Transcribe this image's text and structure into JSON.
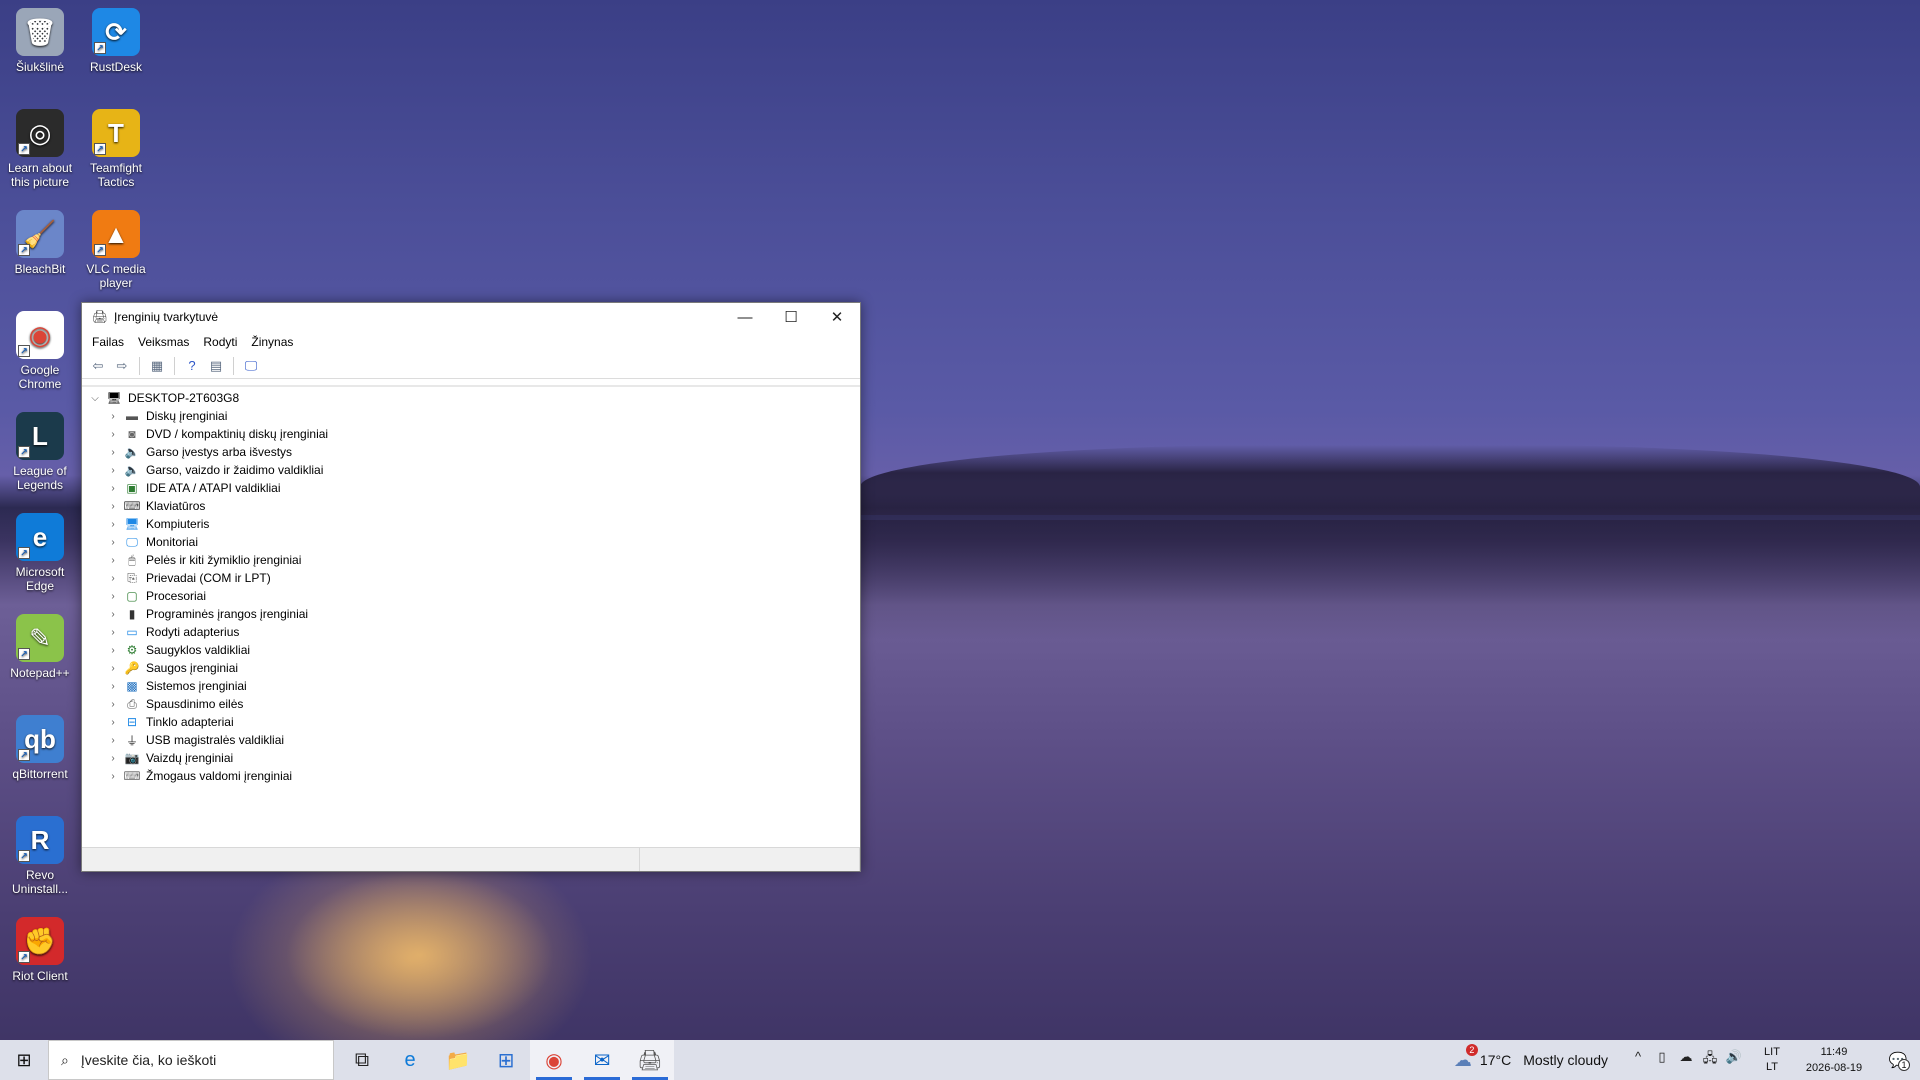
{
  "desktop": {
    "icons": [
      {
        "label": "Šiukšlinė",
        "glyph": "🗑",
        "icon": "recycle-bin-icon"
      },
      {
        "label": "RustDesk",
        "glyph": "⟳",
        "icon": "rustdesk-icon"
      },
      {
        "label": "Learn about this picture",
        "glyph": "◎",
        "icon": "learn-picture-icon"
      },
      {
        "label": "Teamfight Tactics",
        "glyph": "T",
        "icon": "teamfight-tactics-icon"
      },
      {
        "label": "BleachBit",
        "glyph": "🧹",
        "icon": "bleachbit-icon"
      },
      {
        "label": "VLC media player",
        "glyph": "▲",
        "icon": "vlc-icon"
      },
      {
        "label": "Google Chrome",
        "glyph": "◉",
        "icon": "chrome-icon"
      },
      {
        "label": "League of Legends",
        "glyph": "L",
        "icon": "league-of-legends-icon"
      },
      {
        "label": "Microsoft Edge",
        "glyph": "e",
        "icon": "edge-icon"
      },
      {
        "label": "Notepad++",
        "glyph": "✎",
        "icon": "notepad-plus-plus-icon"
      },
      {
        "label": "qBittorrent",
        "glyph": "qb",
        "icon": "qbittorrent-icon"
      },
      {
        "label": "Revo Uninstall...",
        "glyph": "R",
        "icon": "revo-uninstaller-icon"
      },
      {
        "label": "Riot Client",
        "glyph": "✊",
        "icon": "riot-client-icon"
      }
    ]
  },
  "window": {
    "title": "Įrenginių tvarkytuvė",
    "controls": {
      "minimize": "—",
      "maximize": "☐",
      "close": "✕"
    },
    "menu": [
      "Failas",
      "Veiksmas",
      "Rodyti",
      "Žinynas"
    ],
    "toolbar": [
      {
        "glyph": "⇦",
        "icon": "back-arrow-icon"
      },
      {
        "glyph": "⇨",
        "icon": "forward-arrow-icon"
      },
      {
        "glyph": "▦",
        "icon": "properties-view-icon"
      },
      {
        "glyph": "?",
        "icon": "help-icon"
      },
      {
        "glyph": "▤",
        "icon": "details-view-icon"
      },
      {
        "glyph": "🖵",
        "icon": "monitor-scan-icon"
      }
    ],
    "tree": {
      "root": {
        "label": "DESKTOP-2T603G8",
        "glyph": "🖥",
        "icon": "computer-icon"
      },
      "items": [
        {
          "label": "Diskų įrenginiai",
          "glyph": "▬",
          "icon": "disk-drive-icon"
        },
        {
          "label": "DVD / kompaktinių diskų įrenginiai",
          "glyph": "◙",
          "icon": "dvd-drive-icon"
        },
        {
          "label": "Garso įvestys arba išvestys",
          "glyph": "🔈",
          "icon": "audio-io-icon"
        },
        {
          "label": "Garso, vaizdo ir žaidimo valdikliai",
          "glyph": "🔈",
          "icon": "sound-video-game-icon"
        },
        {
          "label": "IDE ATA / ATAPI valdikliai",
          "glyph": "▣",
          "icon": "ide-controller-icon"
        },
        {
          "label": "Klaviatūros",
          "glyph": "⌨",
          "icon": "keyboard-icon"
        },
        {
          "label": "Kompiuteris",
          "glyph": "🖥",
          "icon": "computer-category-icon"
        },
        {
          "label": "Monitoriai",
          "glyph": "🖵",
          "icon": "monitor-icon"
        },
        {
          "label": "Pelės ir kiti žymiklio įrenginiai",
          "glyph": "🖱",
          "icon": "mouse-icon"
        },
        {
          "label": "Prievadai (COM ir LPT)",
          "glyph": "⎘",
          "icon": "ports-icon"
        },
        {
          "label": "Procesoriai",
          "glyph": "▢",
          "icon": "processor-icon"
        },
        {
          "label": "Programinės įrangos įrenginiai",
          "glyph": "▮",
          "icon": "software-device-icon"
        },
        {
          "label": "Rodyti adapterius",
          "glyph": "▭",
          "icon": "display-adapter-icon"
        },
        {
          "label": "Saugyklos valdikliai",
          "glyph": "⚙",
          "icon": "storage-controller-icon"
        },
        {
          "label": "Saugos įrenginiai",
          "glyph": "🔑",
          "icon": "security-device-icon"
        },
        {
          "label": "Sistemos įrenginiai",
          "glyph": "▩",
          "icon": "system-device-icon"
        },
        {
          "label": "Spausdinimo eilės",
          "glyph": "⎙",
          "icon": "print-queue-icon"
        },
        {
          "label": "Tinklo adapteriai",
          "glyph": "⊟",
          "icon": "network-adapter-icon"
        },
        {
          "label": "USB magistralės valdikliai",
          "glyph": "⏚",
          "icon": "usb-controller-icon"
        },
        {
          "label": "Vaizdų įrenginiai",
          "glyph": "📷",
          "icon": "imaging-device-icon"
        },
        {
          "label": "Žmogaus valdomi įrenginiai",
          "glyph": "⌨",
          "icon": "hid-icon"
        }
      ]
    }
  },
  "taskbar": {
    "start_glyph": "⊞",
    "search_placeholder": "Įveskite čia, ko ieškoti",
    "apps": [
      {
        "glyph": "⧉",
        "icon": "task-view-icon",
        "active": false
      },
      {
        "glyph": "e",
        "icon": "edge-taskbar-icon",
        "active": false
      },
      {
        "glyph": "📁",
        "icon": "file-explorer-icon",
        "active": false
      },
      {
        "glyph": "⊞",
        "icon": "microsoft-store-icon",
        "active": false
      },
      {
        "glyph": "◉",
        "icon": "chrome-taskbar-icon",
        "active": true
      },
      {
        "glyph": "✉",
        "icon": "outlook-icon",
        "active": true
      },
      {
        "glyph": "🖨",
        "icon": "device-manager-taskbar-icon",
        "active": true
      }
    ],
    "weather": {
      "temp": "17°C",
      "condition": "Mostly cloudy",
      "badge": "2"
    },
    "tray_icons": [
      {
        "glyph": "^",
        "icon": "show-hidden-icons-icon"
      },
      {
        "glyph": "▯",
        "icon": "device-icon"
      },
      {
        "glyph": "☁",
        "icon": "onedrive-icon"
      },
      {
        "glyph": "🖧",
        "icon": "network-icon"
      },
      {
        "glyph": "🔊",
        "icon": "volume-icon"
      }
    ],
    "lang_top": "LIT",
    "lang_bottom": "LT",
    "time": "11:49",
    "date": "2026-08-19",
    "notification_glyph": "💬",
    "notification_count": "1"
  },
  "colors": {
    "taskbar": "#dde0ea",
    "accent": "#2b6bd6"
  }
}
